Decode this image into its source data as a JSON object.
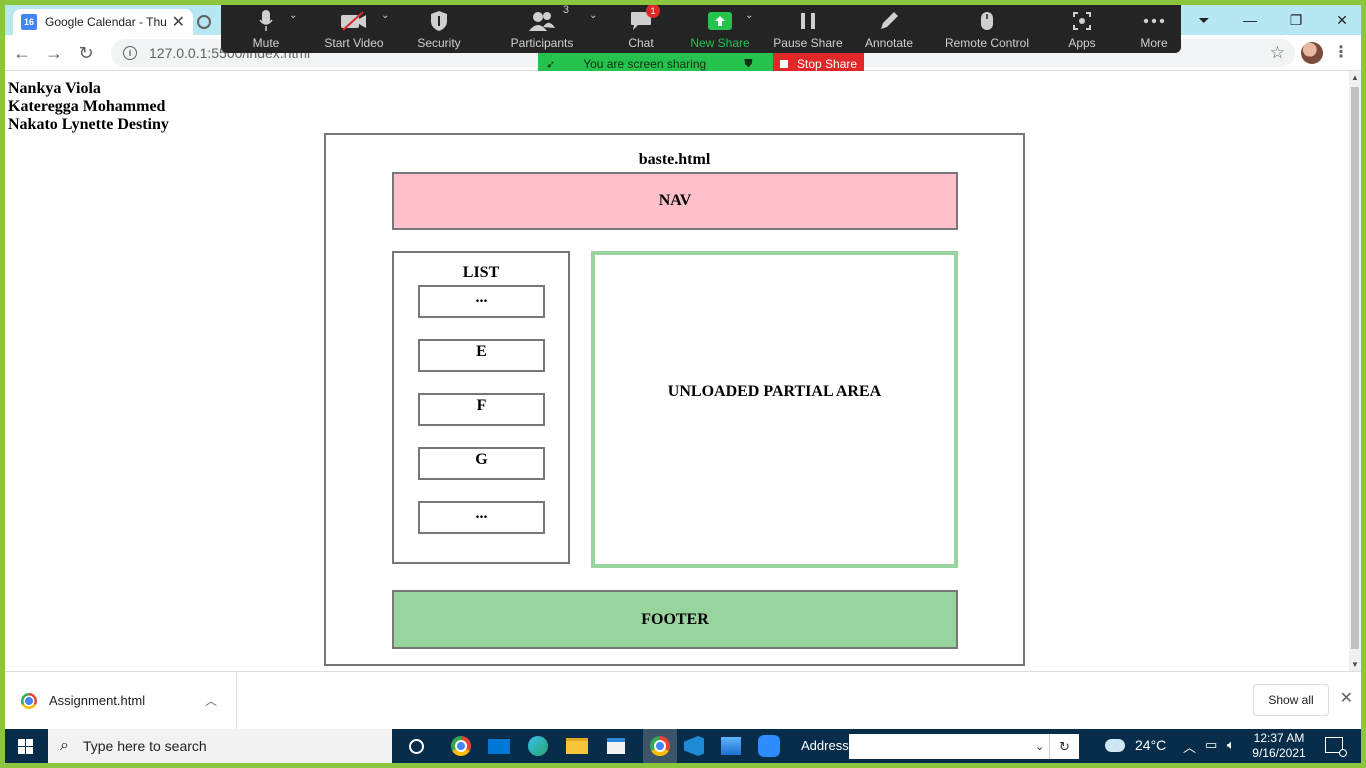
{
  "browser": {
    "tabs": [
      {
        "title": "Google Calendar - Thu"
      }
    ],
    "address": {
      "url": "127.0.0.1:5500/index.html"
    },
    "cal_day": "16"
  },
  "zoom": {
    "buttons": [
      {
        "label": "Mute",
        "icon": "microphone-icon"
      },
      {
        "label": "Start Video",
        "icon": "video-off-icon"
      },
      {
        "label": "Security",
        "icon": "shield-icon"
      },
      {
        "label": "Participants",
        "icon": "participants-icon",
        "count": "3"
      },
      {
        "label": "Chat",
        "icon": "chat-icon",
        "badge": "1"
      },
      {
        "label": "New Share",
        "icon": "share-arrow-icon"
      },
      {
        "label": "Pause Share",
        "icon": "pause-icon"
      },
      {
        "label": "Annotate",
        "icon": "pencil-icon"
      },
      {
        "label": "Remote Control",
        "icon": "mouse-icon"
      },
      {
        "label": "Apps",
        "icon": "apps-icon"
      },
      {
        "label": "More",
        "icon": "ellipsis-icon"
      }
    ],
    "sharing_banner": "You are screen sharing",
    "stop_share": "Stop Share",
    "colors": {
      "toolbar": "#242424",
      "new_share": "#26c24e",
      "stop": "#e02828"
    }
  },
  "page": {
    "names": [
      "Nankya Viola",
      "Kateregga Mohammed",
      "Nakato Lynette Destiny"
    ],
    "diagram": {
      "title": "baste.html",
      "nav": "NAV",
      "list_title": "LIST",
      "list_items": [
        "...",
        "E",
        "F",
        "G",
        "..."
      ],
      "partial": "UNLOADED PARTIAL AREA",
      "footer": "FOOTER"
    },
    "colors": {
      "nav": "#ffc0cb",
      "footer": "#98d49e",
      "partial_border": "#98d49e"
    }
  },
  "downloads": {
    "file": "Assignment.html",
    "show_all": "Show all"
  },
  "taskbar": {
    "search_placeholder": "Type here to search",
    "address_label": "Address",
    "temperature": "24°C",
    "time": "12:37 AM",
    "date": "9/16/2021"
  }
}
